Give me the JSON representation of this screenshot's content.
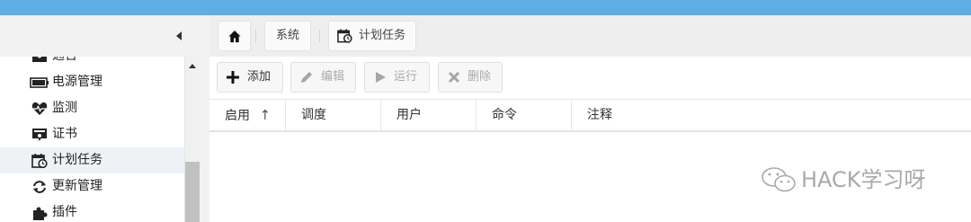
{
  "sidebar": {
    "items": [
      {
        "label": "通告",
        "icon": "envelope-icon"
      },
      {
        "label": "电源管理",
        "icon": "battery-icon"
      },
      {
        "label": "监测",
        "icon": "heart-pulse-icon"
      },
      {
        "label": "证书",
        "icon": "certificate-icon"
      },
      {
        "label": "计划任务",
        "icon": "calendar-clock-icon"
      },
      {
        "label": "更新管理",
        "icon": "refresh-icon"
      },
      {
        "label": "插件",
        "icon": "puzzle-icon"
      }
    ],
    "active_index": 4
  },
  "breadcrumb": {
    "system": "系统",
    "current": "计划任务"
  },
  "toolbar": {
    "add": "添加",
    "edit": "编辑",
    "run": "运行",
    "delete": "删除"
  },
  "table": {
    "columns": [
      "启用",
      "调度",
      "用户",
      "命令",
      "注释"
    ]
  },
  "watermark": {
    "text": "HACK学习呀"
  },
  "colors": {
    "topbar": "#5eaee3",
    "sidebar_bg": "#f2f2f2",
    "active_item_bg": "#eef1f5"
  }
}
